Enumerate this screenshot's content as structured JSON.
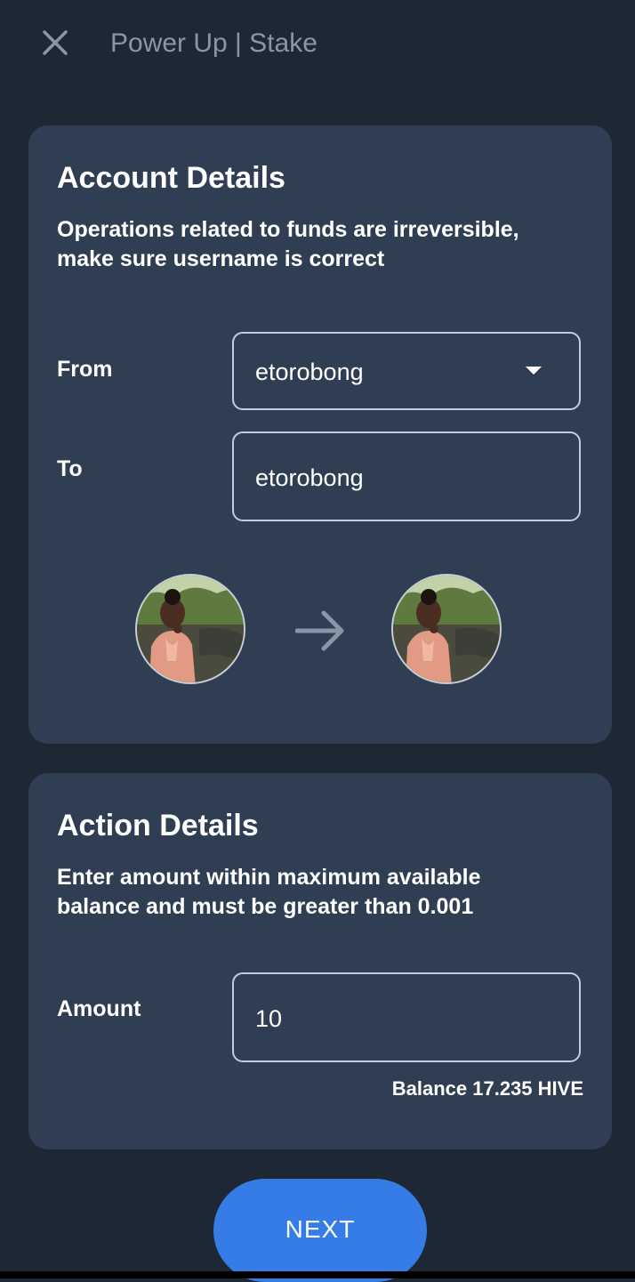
{
  "header": {
    "title": "Power Up | Stake",
    "close_icon": "close-icon"
  },
  "account_details": {
    "title": "Account Details",
    "description": "Operations related to funds are irreversible,\nmake sure username is correct",
    "from_label": "From",
    "from_value": "etorobong",
    "to_label": "To",
    "to_value": "etorobong",
    "from_avatar": "user-avatar",
    "to_avatar": "user-avatar",
    "arrow_icon": "arrow-right-icon"
  },
  "action_details": {
    "title": "Action Details",
    "description": "Enter amount within maximum available\nbalance  and must be greater than 0.001",
    "amount_label": "Amount",
    "amount_value": "10",
    "balance": "Balance 17.235 HIVE"
  },
  "next_button": {
    "label": "NEXT"
  },
  "colors": {
    "background": "#1e2835",
    "card": "#2f3e53",
    "accent": "#357ce6",
    "header_text": "#8b96a5"
  }
}
